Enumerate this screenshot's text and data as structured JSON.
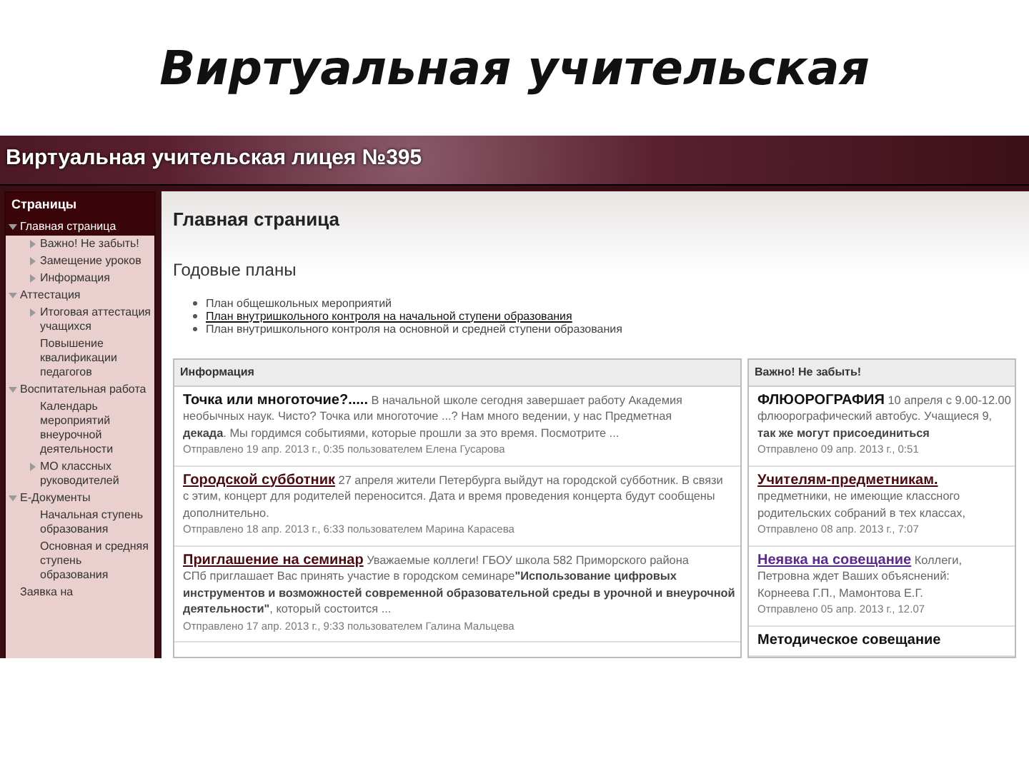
{
  "slide": {
    "title": "Виртуальная учительская"
  },
  "site": {
    "title": "Виртуальная учительская лицея №395"
  },
  "sidebar": {
    "title": "Страницы",
    "items": [
      {
        "label": "Главная страница",
        "kind": "folder",
        "expanded": true,
        "selected": true,
        "children": [
          {
            "label": "Важно! Не забыть!",
            "kind": "folder",
            "expanded": false,
            "selected": false
          },
          {
            "label": "Замещение уроков",
            "kind": "folder",
            "expanded": false,
            "selected": false
          },
          {
            "label": "Информация",
            "kind": "folder",
            "expanded": false,
            "selected": false
          }
        ]
      },
      {
        "label": "Аттестация",
        "kind": "folder",
        "expanded": true,
        "selected": false,
        "children": [
          {
            "label": "Итоговая аттестация учащихся",
            "kind": "folder",
            "expanded": false,
            "selected": false
          },
          {
            "label": "Повышение квалификации педагогов",
            "kind": "page",
            "selected": false
          }
        ]
      },
      {
        "label": "Воспитательная работа",
        "kind": "folder",
        "expanded": true,
        "selected": false,
        "children": [
          {
            "label": "Календарь мероприятий внеурочной деятельности",
            "kind": "page",
            "selected": false
          },
          {
            "label": "МО классных руководителей",
            "kind": "folder",
            "expanded": false,
            "selected": false
          }
        ]
      },
      {
        "label": "Е-Документы",
        "kind": "folder",
        "expanded": true,
        "selected": false,
        "children": [
          {
            "label": "Начальная ступень образования",
            "kind": "page",
            "selected": false
          },
          {
            "label": "Основная и средняя ступень образования",
            "kind": "page",
            "selected": false
          }
        ]
      },
      {
        "label": "Заявка на",
        "kind": "page",
        "selected": false
      }
    ]
  },
  "main": {
    "title": "Главная страница",
    "subtitle": "Годовые планы",
    "links": [
      {
        "label": "План общешкольных мероприятий",
        "hovered": false
      },
      {
        "label": "План внутришкольного контроля на начальной ступени образования",
        "hovered": true
      },
      {
        "label": "План внутришкольного контроля на основной и средней ступени образования",
        "hovered": false
      }
    ]
  },
  "panels": [
    {
      "title": "Информация",
      "posts": [
        {
          "title": "Точка или многоточие?.....",
          "hovered": false,
          "visited": false,
          "lead": "В начальной школе сегодня завершает работу Академия",
          "lines": [
            "необычных наук. Чисто? Точка или многоточие ...? Нам много ведении, у нас Предметная",
            "**декада**. Мы гордимся событиями, которые прошли за это время. Посмотрите ..."
          ],
          "meta": "Отправлено 19 апр. 2013 г., 0:35 пользователем Елена Гусарова"
        },
        {
          "title": "Городской субботник",
          "hovered": true,
          "visited": false,
          "lead": "27 апреля жители Петербурга выйдут на городской субботник. В связи",
          "lines": [
            "с этим, концерт для родителей переносится. Дата и время проведения концерта будут сообщены",
            "дополнительно."
          ],
          "meta": "Отправлено 18 апр. 2013 г., 6:33 пользователем Марина Карасева"
        },
        {
          "title": "Приглашение на семинар",
          "hovered": true,
          "visited": false,
          "lead": "Уважаемые коллеги! ГБОУ школа 582 Приморского района",
          "lines": [
            "СПб приглашает Вас принять участие в городском семинаре**\"Использование цифровых**",
            "**инструментов и возможностей современной образовательной среды в урочной и внеурочной**",
            "**деятельности\"**, который состоится ..."
          ],
          "meta": "Отправлено 17 апр. 2013 г., 9:33 пользователем Галина Мальцева"
        }
      ]
    },
    {
      "title": "Важно! Не забыть!",
      "posts": [
        {
          "title": "ФЛЮОРОГРАФИЯ",
          "hovered": false,
          "visited": false,
          "lead": "10 апреля с 9.00-12.00",
          "lines": [
            "флюорографический автобус. Учащиеся 9,",
            "**так же могут присоединиться**"
          ],
          "meta": "Отправлено 09 апр. 2013 г., 0:51"
        },
        {
          "title": "Учителям-предметникам.",
          "hovered": true,
          "visited": false,
          "lines": [
            "предметники, не имеющие классного",
            "родительских собраний в тех классах,"
          ],
          "meta": "Отправлено 08 апр. 2013 г., 7:07"
        },
        {
          "title": "Неявка на совещание",
          "hovered": true,
          "visited": true,
          "lead": "Коллеги,",
          "lines": [
            "Петровна ждет Ваших объяснений:",
            "Корнеева Г.П., Мамонтова Е.Г."
          ],
          "meta": "Отправлено 05 апр. 2013 г., 12.07"
        },
        {
          "title": "Методическое совещание",
          "hovered": false,
          "visited": false
        }
      ]
    }
  ]
}
